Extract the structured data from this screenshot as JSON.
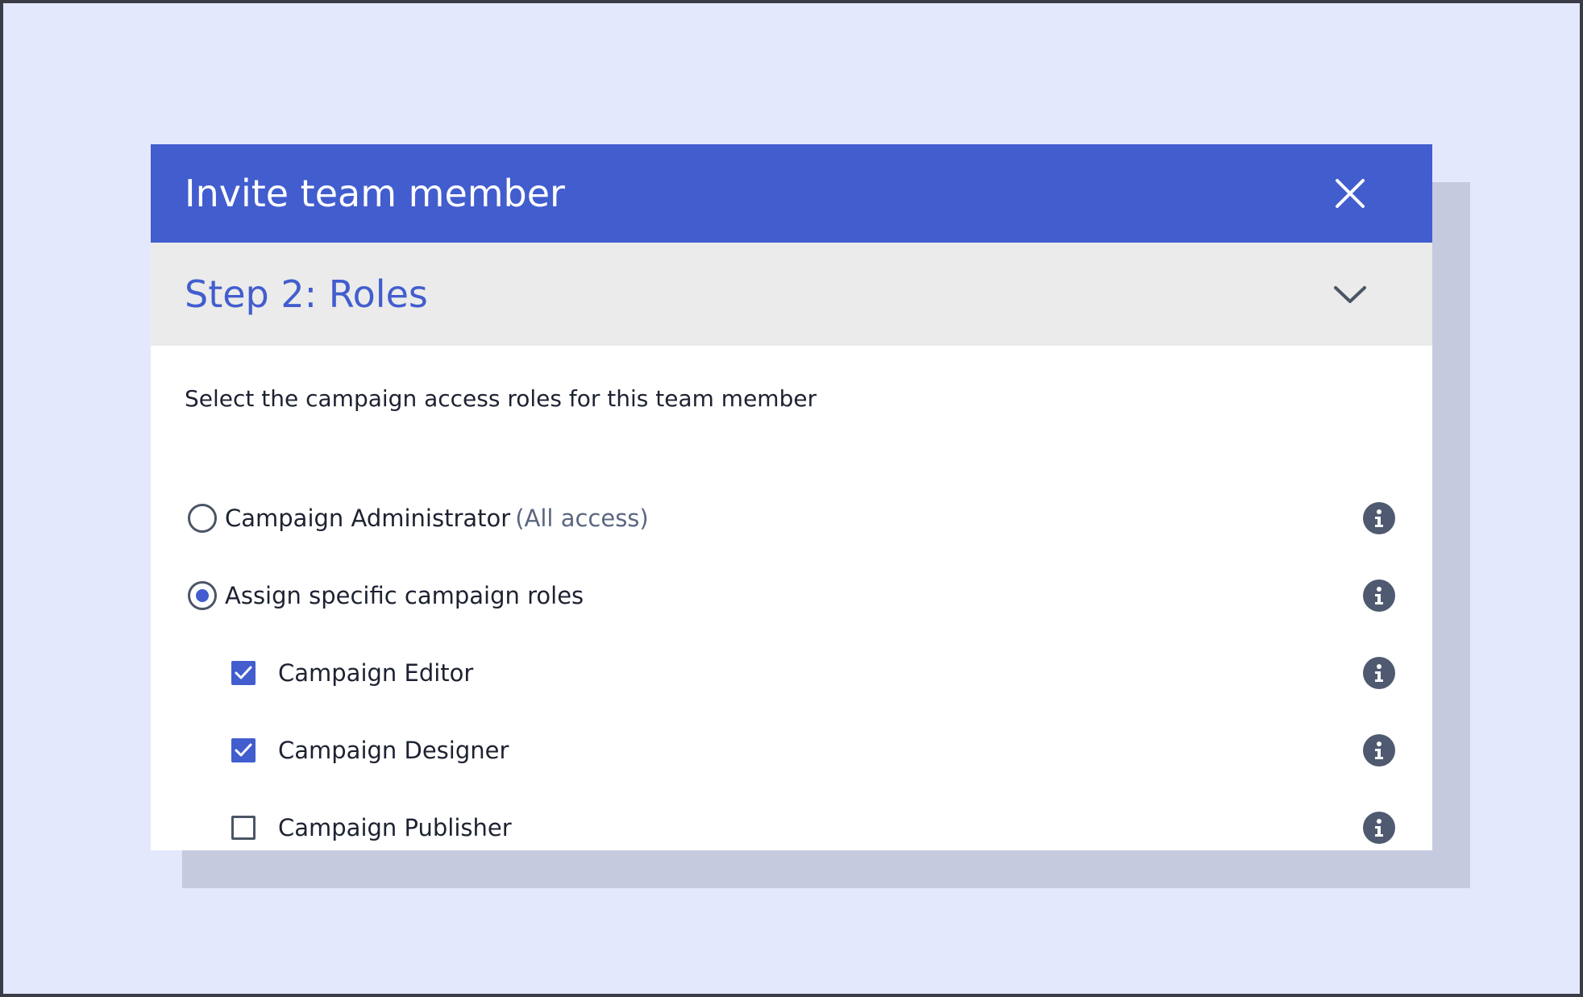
{
  "modal": {
    "title": "Invite team member",
    "close_icon": "close-icon"
  },
  "step": {
    "title": "Step 2: Roles",
    "chevron_icon": "chevron-down-icon"
  },
  "instruction": "Select the campaign access roles for this team member",
  "access_options": [
    {
      "label": "Campaign Administrator",
      "sub_label": "(All access)",
      "selected": false
    },
    {
      "label": "Assign specific campaign roles",
      "selected": true
    }
  ],
  "roles": [
    {
      "label": "Campaign Editor",
      "checked": true
    },
    {
      "label": "Campaign Designer",
      "checked": true
    },
    {
      "label": "Campaign Publisher",
      "checked": false
    }
  ],
  "info_icon": "info-icon",
  "colors": {
    "background": "#e3e8fd",
    "accent": "#425dce",
    "step_bar": "#ebebeb",
    "shadow": "#c5cadf",
    "info_icon": "#4f5a70"
  }
}
